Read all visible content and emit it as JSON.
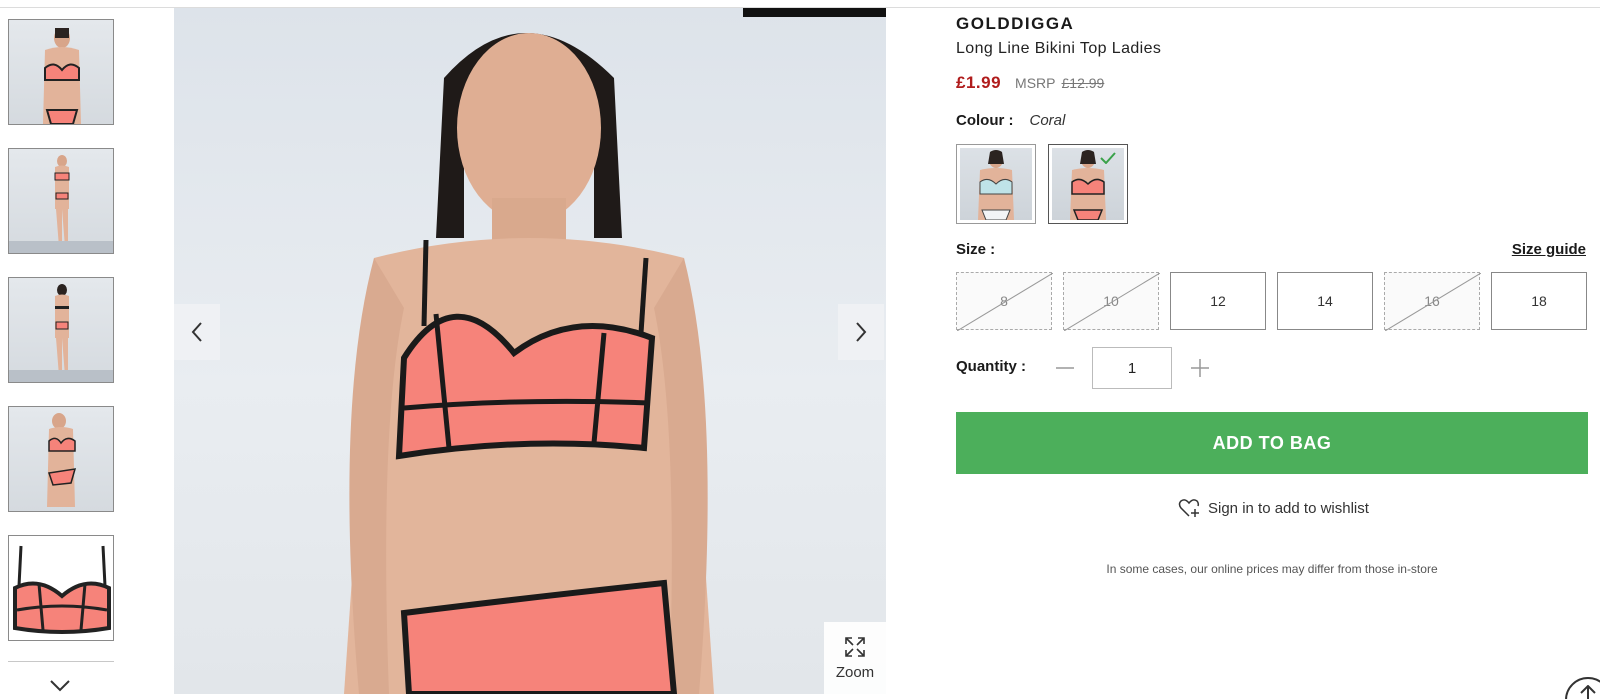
{
  "product": {
    "brand": "GOLDDIGGA",
    "title": "Long Line Bikini Top Ladies",
    "price": "£1.99",
    "msrp_label": "MSRP",
    "old_price": "£12.99"
  },
  "colour": {
    "label": "Colour :",
    "value": "Coral",
    "swatches": [
      {
        "name": "White",
        "selected": false
      },
      {
        "name": "Coral",
        "selected": true
      }
    ]
  },
  "size": {
    "label": "Size :",
    "guide_label": "Size guide",
    "options": [
      {
        "label": "8",
        "available": false
      },
      {
        "label": "10",
        "available": false
      },
      {
        "label": "12",
        "available": true
      },
      {
        "label": "14",
        "available": true
      },
      {
        "label": "16",
        "available": false
      },
      {
        "label": "18",
        "available": true
      }
    ]
  },
  "quantity": {
    "label": "Quantity :",
    "value": "1"
  },
  "add_to_bag_label": "ADD TO BAG",
  "wishlist_label": "Sign in to add to wishlist",
  "disclaimer": "In some cases, our online prices may differ from those in-store",
  "gallery": {
    "zoom_label": "Zoom",
    "thumbnail_count": 5
  },
  "colors": {
    "accent_green": "#4caf5b",
    "price_red": "#b01c1c",
    "coral": "#f6837a"
  }
}
